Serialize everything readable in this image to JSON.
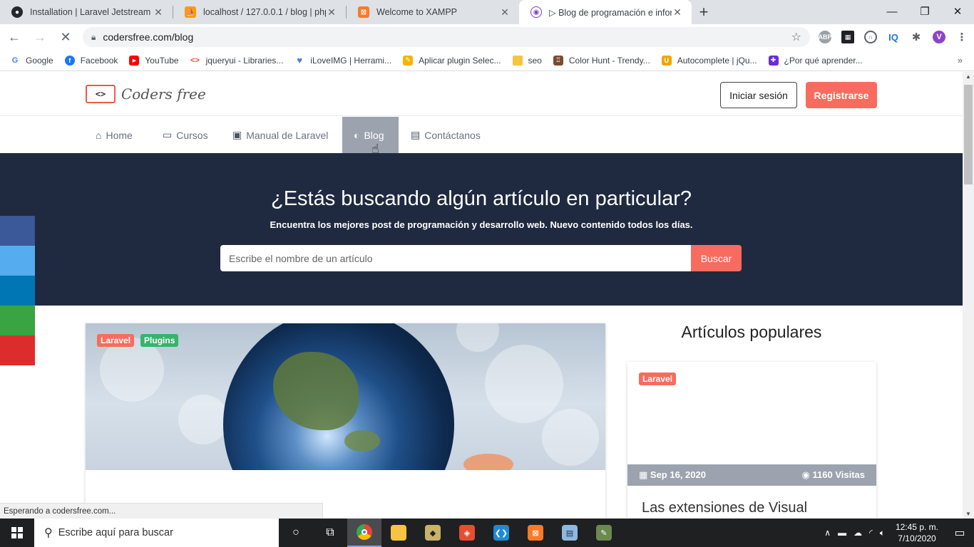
{
  "browser": {
    "tabs": [
      {
        "title": "Installation | Laravel Jetstream",
        "icon": "github-icon",
        "active": false
      },
      {
        "title": "localhost / 127.0.0.1 / blog | php",
        "icon": "phpmyadmin-icon",
        "active": false
      },
      {
        "title": "Welcome to XAMPP",
        "icon": "xampp-icon",
        "active": false
      },
      {
        "title": "▷ Blog de programación e inforr",
        "icon": "codersfree-icon",
        "active": true
      }
    ],
    "url": "codersfree.com/blog",
    "bookmarks": [
      {
        "label": "Google",
        "color": "#4285f4",
        "glyph": "G"
      },
      {
        "label": "Facebook",
        "color": "#1877f2",
        "glyph": "f"
      },
      {
        "label": "YouTube",
        "color": "#ff0000",
        "glyph": "▶"
      },
      {
        "label": "jqueryui - Libraries...",
        "color": "#e44d26",
        "glyph": "<>"
      },
      {
        "label": "iLoveIMG | Herrami...",
        "color": "#4a7bd0",
        "glyph": "♥"
      },
      {
        "label": "Aplicar plugin Selec...",
        "color": "#f4b400",
        "glyph": "✎"
      },
      {
        "label": "seo",
        "color": "#f6c343",
        "glyph": ""
      },
      {
        "label": "Color Hunt - Trendy...",
        "color": "#7b4a2e",
        "glyph": "♖"
      },
      {
        "label": "Autocomplete | jQu...",
        "color": "#f0a500",
        "glyph": "U"
      },
      {
        "label": "¿Por qué aprender...",
        "color": "#6a2bd8",
        "glyph": "✚"
      }
    ],
    "status_text": "Esperando a codersfree.com..."
  },
  "site": {
    "logo_text": "Coders free",
    "login_label": "Iniciar sesión",
    "register_label": "Registrarse",
    "nav": [
      {
        "label": "Home",
        "icon": "home-icon",
        "glyph": "⌂"
      },
      {
        "label": "Cursos",
        "icon": "laptop-icon",
        "glyph": "▭"
      },
      {
        "label": "Manual de Laravel",
        "icon": "teacher-icon",
        "glyph": "▣"
      },
      {
        "label": "Blog",
        "icon": "blog-icon",
        "glyph": "◐"
      },
      {
        "label": "Contáctanos",
        "icon": "contact-card-icon",
        "glyph": "▤"
      }
    ],
    "active_nav": "Blog"
  },
  "hero": {
    "title": "¿Estás buscando algún artículo en particular?",
    "subtitle": "Encuentra los mejores post de programación y desarrollo web. Nuevo contenido todos los días.",
    "search_placeholder": "Escribe el nombre de un artículo",
    "search_button": "Buscar"
  },
  "social_colors": [
    "#3b5998",
    "#55acee",
    "#0077b5",
    "#3aa342",
    "#dd2c2c"
  ],
  "featured_article": {
    "tags": [
      {
        "label": "Laravel",
        "color": "#f76c5e"
      },
      {
        "label": "Plugins",
        "color": "#37b36b"
      }
    ]
  },
  "popular": {
    "title": "Artículos populares",
    "cards": [
      {
        "tag": "Laravel",
        "tag_color": "#f76c5e",
        "date": "Sep 16, 2020",
        "visits": "1160 Visitas",
        "title": "Las extensiones de Visual"
      }
    ]
  },
  "taskbar": {
    "search_placeholder": "Escribe aquí para buscar",
    "time": "12:45 p. m.",
    "date": "7/10/2020"
  }
}
